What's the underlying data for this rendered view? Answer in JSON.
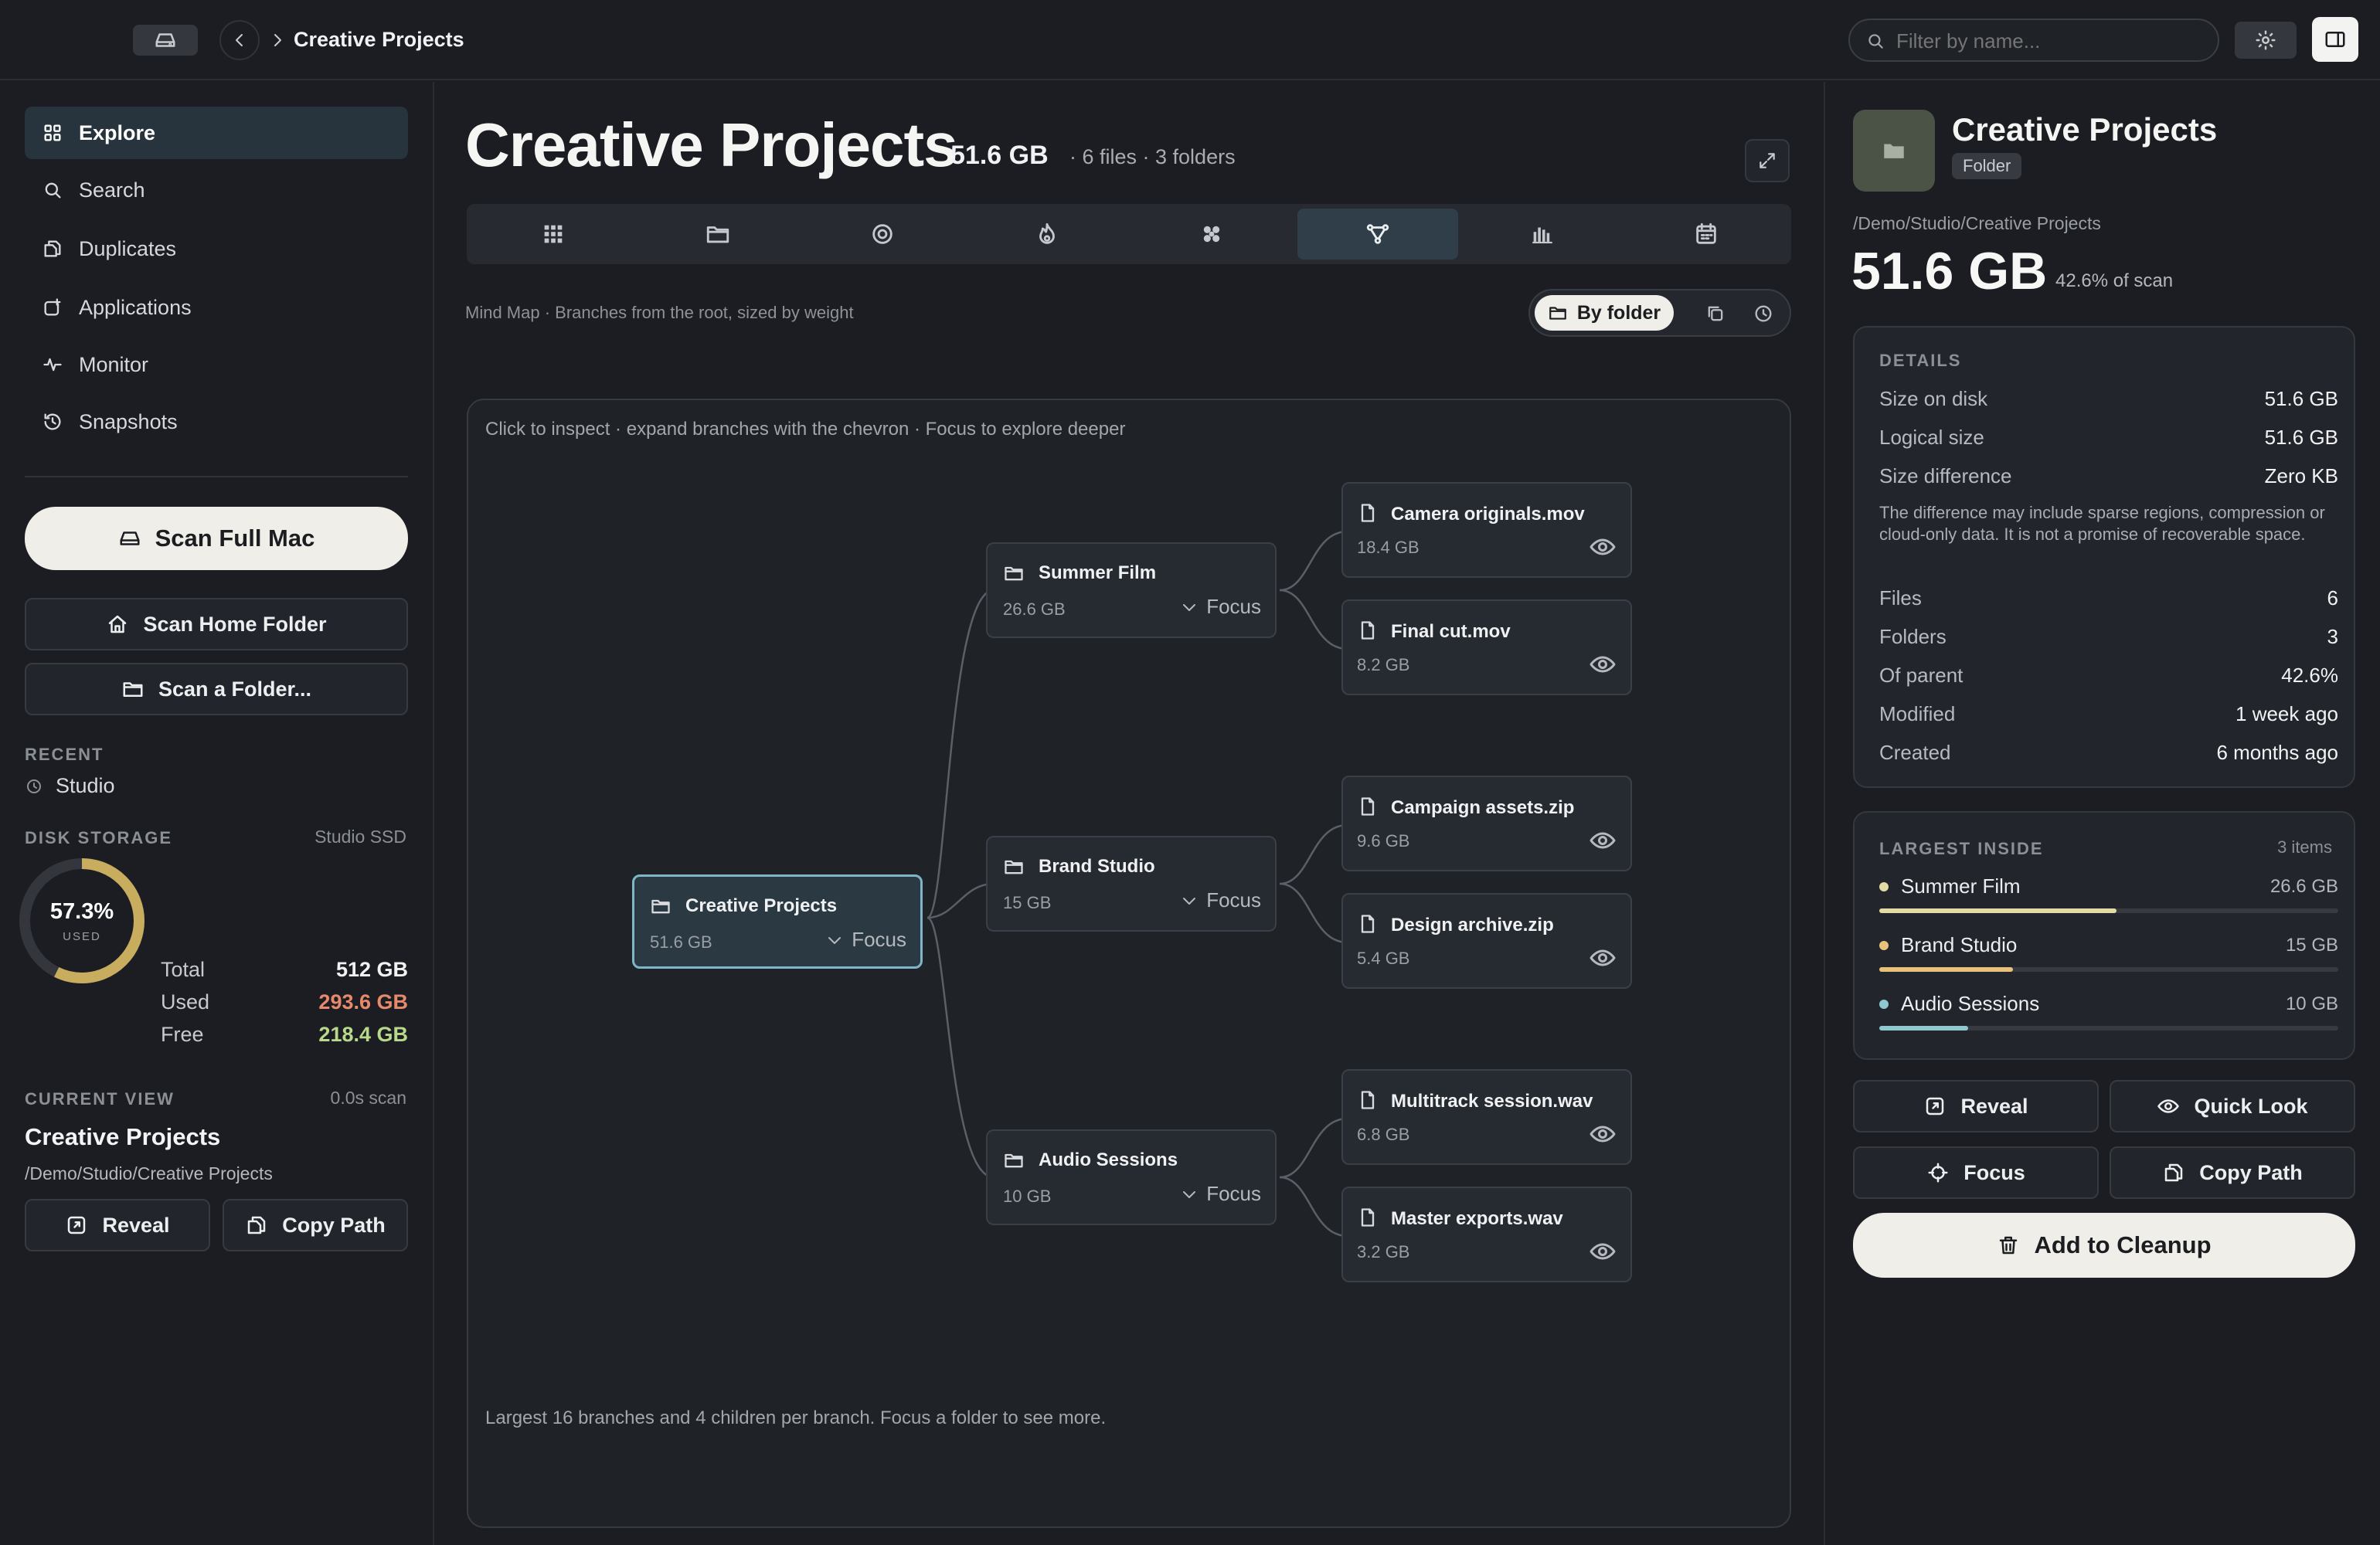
{
  "topbar": {
    "breadcrumb": "Creative Projects",
    "filter_placeholder": "Filter by name..."
  },
  "sidebar": {
    "nav": [
      {
        "label": "Explore",
        "icon": "grid-icon",
        "active": true
      },
      {
        "label": "Search",
        "icon": "search-icon"
      },
      {
        "label": "Duplicates",
        "icon": "duplicate-icon"
      },
      {
        "label": "Applications",
        "icon": "app-icon"
      },
      {
        "label": "Monitor",
        "icon": "pulse-icon"
      },
      {
        "label": "Snapshots",
        "icon": "history-icon"
      }
    ],
    "scan_full": "Scan Full Mac",
    "scan_home": "Scan Home Folder",
    "scan_folder": "Scan a Folder...",
    "recent_label": "RECENT",
    "recent_item": "Studio",
    "disk_label": "DISK STORAGE",
    "disk_name": "Studio SSD",
    "disk_percent": "57.3%",
    "disk_used_caption": "USED",
    "disk_used_fraction": 0.573,
    "disk_rows": [
      {
        "k": "Total",
        "v": "512 GB",
        "color": "#f2f2f2"
      },
      {
        "k": "Used",
        "v": "293.6 GB",
        "color": "#e6896c"
      },
      {
        "k": "Free",
        "v": "218.4 GB",
        "color": "#b9d98a"
      }
    ],
    "current_label": "CURRENT VIEW",
    "current_time": "0.0s scan",
    "current_title": "Creative Projects",
    "current_path": "/Demo/Studio/Creative Projects",
    "reveal": "Reveal",
    "copy_path": "Copy Path"
  },
  "main": {
    "title": "Creative Projects",
    "size": "51.6 GB",
    "meta": "· 6 files · 3 folders",
    "tabs": [
      {
        "icon": "treemap-icon"
      },
      {
        "icon": "folder-icon"
      },
      {
        "icon": "sunburst-icon"
      },
      {
        "icon": "flame-icon"
      },
      {
        "icon": "bubbles-icon"
      },
      {
        "icon": "mindmap-icon",
        "active": true
      },
      {
        "icon": "bar-chart-icon"
      },
      {
        "icon": "calendar-icon"
      }
    ],
    "view_caption": "Mind Map · Branches from the root, sized by weight",
    "group_label": "By folder",
    "canvas_hint": "Click to inspect · expand branches with the chevron · Focus to explore deeper",
    "canvas_footer": "Largest 16 branches and 4 children per branch. Focus a folder to see more.",
    "focus_label": "Focus",
    "root": {
      "name": "Creative Projects",
      "size": "51.6 GB"
    },
    "branches": [
      {
        "name": "Summer Film",
        "size": "26.6 GB",
        "children": [
          {
            "name": "Camera originals.mov",
            "size": "18.4 GB"
          },
          {
            "name": "Final cut.mov",
            "size": "8.2 GB"
          }
        ]
      },
      {
        "name": "Brand Studio",
        "size": "15 GB",
        "children": [
          {
            "name": "Campaign assets.zip",
            "size": "9.6 GB"
          },
          {
            "name": "Design archive.zip",
            "size": "5.4 GB"
          }
        ]
      },
      {
        "name": "Audio Sessions",
        "size": "10 GB",
        "children": [
          {
            "name": "Multitrack session.wav",
            "size": "6.8 GB"
          },
          {
            "name": "Master exports.wav",
            "size": "3.2 GB"
          }
        ]
      }
    ]
  },
  "inspector": {
    "title": "Creative Projects",
    "kind": "Folder",
    "path": "/Demo/Studio/Creative Projects",
    "size": "51.6 GB",
    "size_share": "42.6% of scan",
    "details_label": "DETAILS",
    "details": [
      {
        "k": "Size on disk",
        "v": "51.6 GB"
      },
      {
        "k": "Logical size",
        "v": "51.6 GB"
      },
      {
        "k": "Size difference",
        "v": "Zero KB"
      }
    ],
    "note": "The difference may include sparse regions, compression or cloud-only data. It is not a promise of recoverable space.",
    "details2": [
      {
        "k": "Files",
        "v": "6"
      },
      {
        "k": "Folders",
        "v": "3"
      },
      {
        "k": "Of parent",
        "v": "42.6%"
      },
      {
        "k": "Modified",
        "v": "1 week ago"
      },
      {
        "k": "Created",
        "v": "6 months ago"
      }
    ],
    "largest_label": "LARGEST INSIDE",
    "largest_count": "3 items",
    "largest": [
      {
        "name": "Summer Film",
        "size": "26.6 GB",
        "fraction": 0.516,
        "color": "#e4dba6"
      },
      {
        "name": "Brand Studio",
        "size": "15 GB",
        "fraction": 0.291,
        "color": "#e8c27a"
      },
      {
        "name": "Audio Sessions",
        "size": "10 GB",
        "fraction": 0.194,
        "color": "#8fc9cf"
      }
    ],
    "reveal": "Reveal",
    "quick_look": "Quick Look",
    "focus": "Focus",
    "copy_path": "Copy Path",
    "cleanup": "Add to Cleanup"
  }
}
